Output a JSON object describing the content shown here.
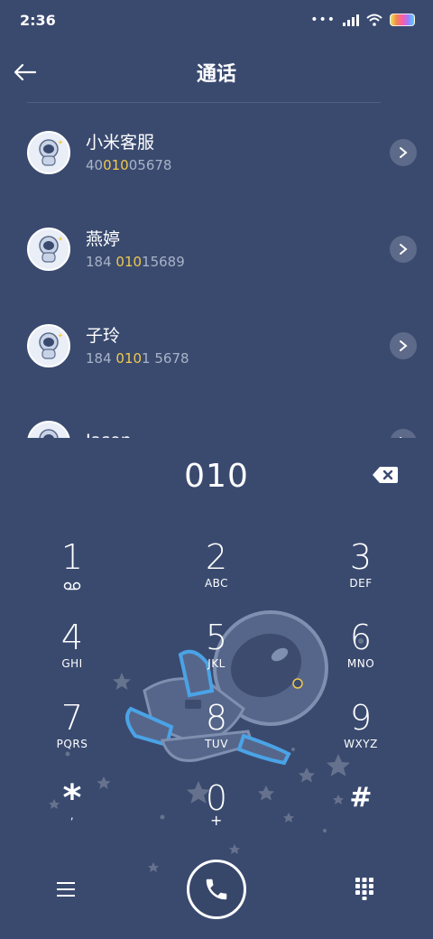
{
  "status_bar": {
    "time": "2:36",
    "icons": [
      "more-dots-icon",
      "signal-icon",
      "wifi-icon",
      "battery-icon"
    ]
  },
  "header": {
    "title": "通话",
    "back_icon": "arrow-left-icon"
  },
  "contacts": [
    {
      "name": "小米客服",
      "number_parts": [
        "40",
        "010",
        "05678"
      ]
    },
    {
      "name": "燕婷",
      "number_parts": [
        "184 ",
        "010",
        "15689"
      ]
    },
    {
      "name": "子玲",
      "number_parts": [
        "184 ",
        "010",
        "1 5678"
      ]
    },
    {
      "name": "Jason",
      "number_parts": [
        "",
        "",
        ""
      ]
    }
  ],
  "dialpad": {
    "input_value": "010",
    "keys": [
      {
        "digit": "1",
        "letters": "voicemail"
      },
      {
        "digit": "2",
        "letters": "ABC"
      },
      {
        "digit": "3",
        "letters": "DEF"
      },
      {
        "digit": "4",
        "letters": "GHI"
      },
      {
        "digit": "5",
        "letters": "JKL"
      },
      {
        "digit": "6",
        "letters": "MNO"
      },
      {
        "digit": "7",
        "letters": "PQRS"
      },
      {
        "digit": "8",
        "letters": "TUV"
      },
      {
        "digit": "9",
        "letters": "WXYZ"
      },
      {
        "digit": "*",
        "letters": ","
      },
      {
        "digit": "0",
        "letters": "+"
      },
      {
        "digit": "#",
        "letters": ""
      }
    ]
  },
  "bottom_bar": {
    "icons": [
      "menu-icon",
      "phone-icon",
      "keypad-icon"
    ]
  },
  "colors": {
    "background": "#3a4a6f",
    "highlight": "#f2c94c",
    "secondary_text": "#a9b3c8"
  }
}
